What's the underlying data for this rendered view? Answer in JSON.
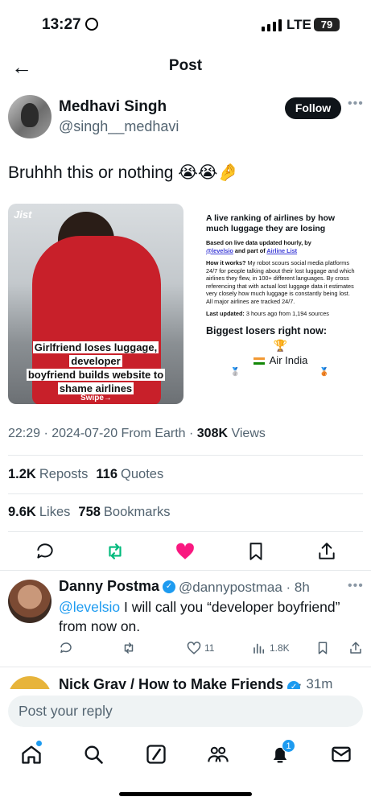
{
  "status_bar": {
    "time": "13:27",
    "network": "LTE",
    "battery": "79"
  },
  "header": {
    "title": "Post"
  },
  "post": {
    "author_name": "Medhavi Singh",
    "author_handle": "@singh__medhavi",
    "follow_label": "Follow",
    "text": "Bruhhh this or nothing 😭😭🤌",
    "media_left": {
      "brand": "Jist",
      "caption_lines": [
        "Girlfriend loses luggage, developer",
        "boyfriend builds website to",
        "shame airlines"
      ],
      "swipe": "Swipe→"
    },
    "media_right": {
      "title": "A live ranking of airlines by how much luggage they are losing",
      "subtitle_pre": "Based on live data updated hourly, by",
      "subtitle_link1": "@levelsio",
      "subtitle_mid": "and part of",
      "subtitle_link2": "Airline List",
      "how_label": "How it works?",
      "how_text": "My robot scours social media platforms 24/7 for people talking about their lost luggage and which airlines they flew, in 100+ different languages. By cross referencing that with actual lost luggage data it estimates very closely how much luggage is constantly being lost. All major airlines are tracked 24/7.",
      "updated_label": "Last updated:",
      "updated_text": "3 hours ago from 1,194 sources",
      "losers_title": "Biggest losers right now:",
      "top_airline": "Air India"
    },
    "timestamp": "22:29 · 2024-07-20 From Earth · ",
    "views_count": "308K",
    "views_label": "Views",
    "reposts_count": "1.2K",
    "reposts_label": "Reposts",
    "quotes_count": "116",
    "quotes_label": "Quotes",
    "likes_count": "9.6K",
    "likes_label": "Likes",
    "bookmarks_count": "758",
    "bookmarks_label": "Bookmarks",
    "liked": true,
    "like_color": "#f91880",
    "repost_color": "#00ba7c"
  },
  "reply": {
    "name": "Danny Postma",
    "handle_time": "@dannypostmaa · 8h",
    "mention": "@levelsio",
    "text": " I will call you “developer boyfriend” from now on.",
    "likes": "11",
    "views": "1.8K"
  },
  "next_reply": {
    "name": "Nick Gray / How to Make Friends",
    "time": "· 31m"
  },
  "composer": {
    "placeholder": "Post your reply"
  },
  "tabbar": {
    "notifications_badge": "1"
  },
  "colors": {
    "accent": "#1d9bf0",
    "text": "#0f1419",
    "muted": "#536471"
  }
}
